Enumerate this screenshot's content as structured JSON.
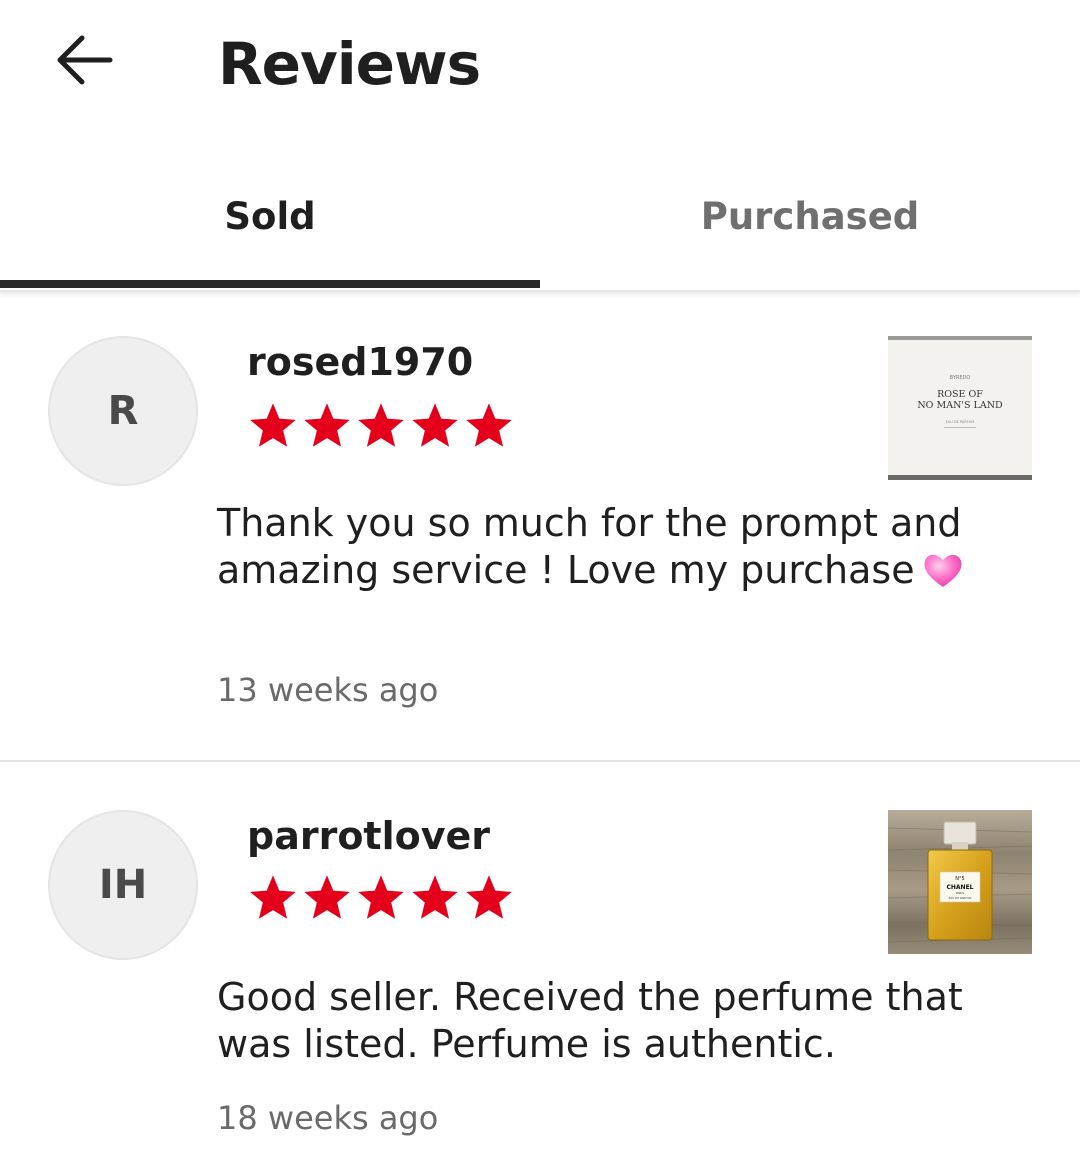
{
  "header": {
    "title": "Reviews",
    "back_icon": "arrow-left-icon"
  },
  "tabs": [
    {
      "label": "Sold",
      "selected": true
    },
    {
      "label": "Purchased",
      "selected": false
    }
  ],
  "reviews": [
    {
      "avatar_initials": "R",
      "username": "rosed1970",
      "rating": 5,
      "text": "Thank you so much for the prompt and amazing service ! Love my purchase",
      "emoji": "pink-heart-icon",
      "time": "13 weeks ago",
      "thumbnail": {
        "brand": "BYREDO",
        "line1": "ROSE OF",
        "line2": "NO MAN'S LAND",
        "line3": "EAU DE PARFUM"
      }
    },
    {
      "avatar_initials": "IH",
      "username": "parrotlover",
      "rating": 5,
      "text": "Good seller. Received the perfume that was listed. Perfume is authentic.",
      "time": "18 weeks ago",
      "thumbnail": {
        "line1": "N°5",
        "line2": "CHANEL",
        "line3": "PARIS",
        "line4": "EAU DE PARFUM"
      }
    }
  ],
  "colors": {
    "star": "#e4001b",
    "tab_indicator": "#2a2a2a",
    "heart": "#ff6fc8"
  }
}
